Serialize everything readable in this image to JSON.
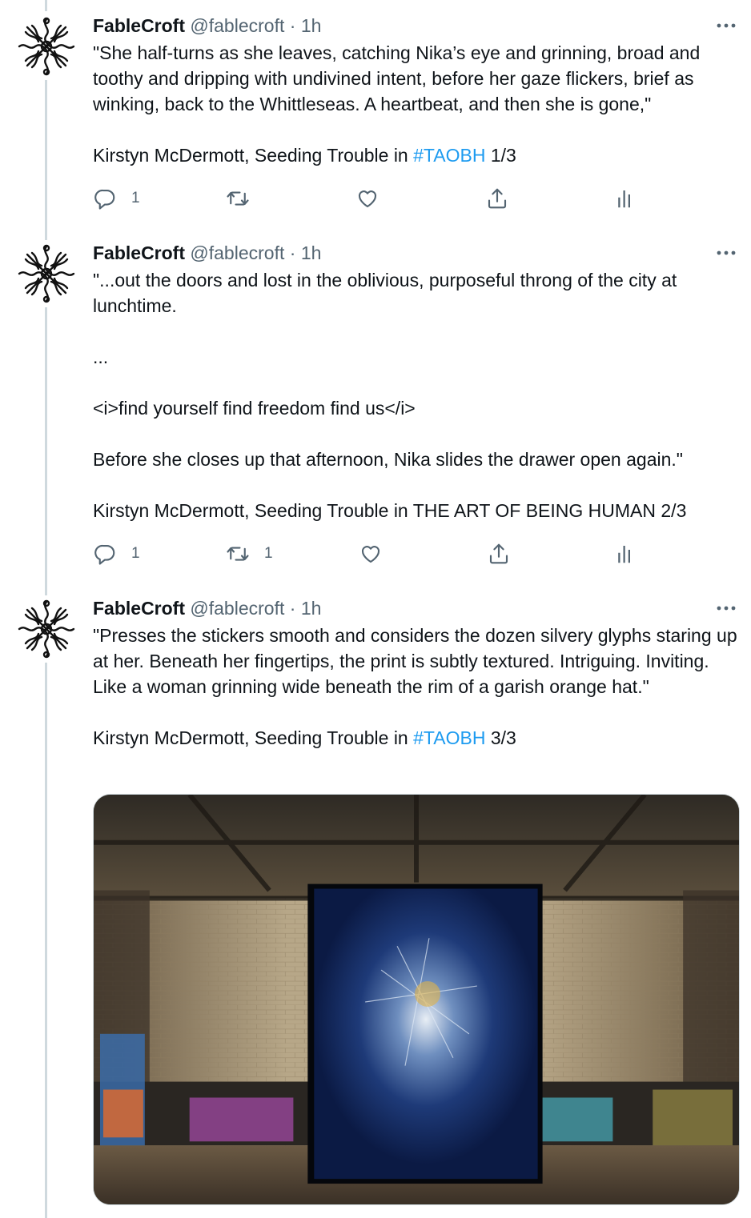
{
  "tweets": [
    {
      "name": "FableCroft",
      "handle": "@fablecroft",
      "separator": "·",
      "time": "1h",
      "body": "\"She half-turns as she leaves, catching Nika’s eye and grinning, broad and toothy and dripping with undivined intent, before her gaze flickers, brief as winking, back to the Whittleseas. A heartbeat, and then she is gone,\"",
      "credit_prefix": "Kirstyn McDermott, Seeding Trouble in ",
      "credit_tag": "#TAOBH",
      "credit_suffix": " 1/3",
      "replies": "1",
      "retweets": "",
      "likes": ""
    },
    {
      "name": "FableCroft",
      "handle": "@fablecroft",
      "separator": "·",
      "time": "1h",
      "paragraphs": [
        "\"...out the doors and lost in the oblivious, purposeful throng of the city at lunchtime.",
        "...",
        "<i>find yourself find freedom find us</i>",
        "Before she closes up that afternoon, Nika slides the drawer open again.\"",
        "Kirstyn McDermott, Seeding Trouble in THE ART OF BEING HUMAN 2/3"
      ],
      "replies": "1",
      "retweets": "1",
      "likes": ""
    },
    {
      "name": "FableCroft",
      "handle": "@fablecroft",
      "separator": "·",
      "time": "1h",
      "body": "\"Presses the stickers smooth and considers the dozen silvery glyphs staring up at her. Beneath her fingertips, the print is subtly textured. Intriguing. Inviting. Like a woman grinning wide beneath the rim of a garish orange hat.\"",
      "credit_prefix": "Kirstyn McDermott, Seeding Trouble in ",
      "credit_tag": "#TAOBH",
      "credit_suffix": " 3/3",
      "media_alt": ""
    }
  ],
  "icons": {
    "avatar": "fablecroft-knot-logo",
    "more": "more-dots-icon",
    "reply": "reply-bubble-icon",
    "retweet": "retweet-arrows-icon",
    "like": "heart-icon",
    "share": "share-upload-icon",
    "analytics": "analytics-bars-icon"
  },
  "colors": {
    "text": "#0f1419",
    "secondary": "#536471",
    "link": "#1d9bf0",
    "thread_line": "#cfd9de"
  }
}
